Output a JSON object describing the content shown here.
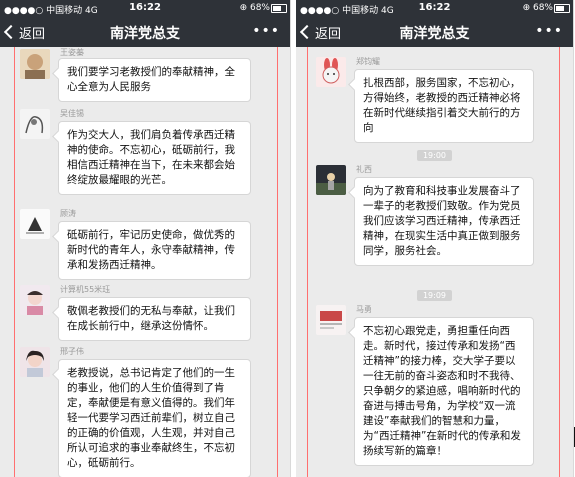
{
  "status_bar": {
    "carrier": "●●●●○ 中国移动",
    "network": "4G",
    "time": "16:22",
    "battery": "68%",
    "battery_level": 0.68
  },
  "nav": {
    "back_label": "返回",
    "title": "南洋党总支",
    "more_label": "•••"
  },
  "left_messages": [
    {
      "sender": "王姿蓁",
      "text": "我们要学习老教授们的奉献精神，全心全意为人民服务"
    },
    {
      "sender": "吴佳锡",
      "text": "作为交大人，我们肩负着传承西迁精神的使命。不忘初心，砥砺前行，我相信西迁精神在当下，在未来都会始终绽放最耀眼的光芒。"
    },
    {
      "sender": "顾涛",
      "text": "砥砺前行，牢记历史使命，做优秀的新时代的青年人，永守奉献精神，传承和发扬西迁精神。"
    },
    {
      "sender": "计算机55米珏",
      "text": "敬佩老教授们的无私与奉献，让我们在成长前行中，继承这份情怀。"
    },
    {
      "sender": "邢子伟",
      "text": "老教授说，总书记肯定了他们的一生的事业，他们的人生价值得到了肯定，奉献便是有意义值得的。我们年轻一代要学习西迁前辈们，树立自己的正确的价值观，人生观，并对自己所认可追求的事业奉献终生，不忘初心，砥砺前行。"
    }
  ],
  "right_messages": [
    {
      "sender": "郑钧耀",
      "text": "扎根西部，服务国家，不忘初心，方得始终，老教授的西迁精神必将在新时代继续指引着交大前行的方向"
    },
    {
      "time": "19:00"
    },
    {
      "sender": "礼西",
      "text": "向为了教育和科技事业发展奋斗了一辈子的老教授们致敬。作为党员我们应该学习西迁精神，传承西迁精神，在现实生活中真正做到服务同学，服务社会。"
    },
    {
      "time": "19:09"
    },
    {
      "sender": "马勇",
      "text": "不忘初心跟党走，勇担重任向西走。新时代，接过传承和发扬“西迁精神”的接力棒，交大学子要以一往无前的奋斗姿态和时不我待、只争朝夕的紧迫感，唱响新时代的奋进与搏击号角，为学校“双一流建设”奉献我们的智慧和力量，为“西迁精神”在新时代的传承和发扬续写新的篇章！"
    }
  ],
  "colors": {
    "header": "#2e3238",
    "background": "#ebebeb",
    "bubble": "#ffffff",
    "accent_line": "#ff6f6f"
  }
}
